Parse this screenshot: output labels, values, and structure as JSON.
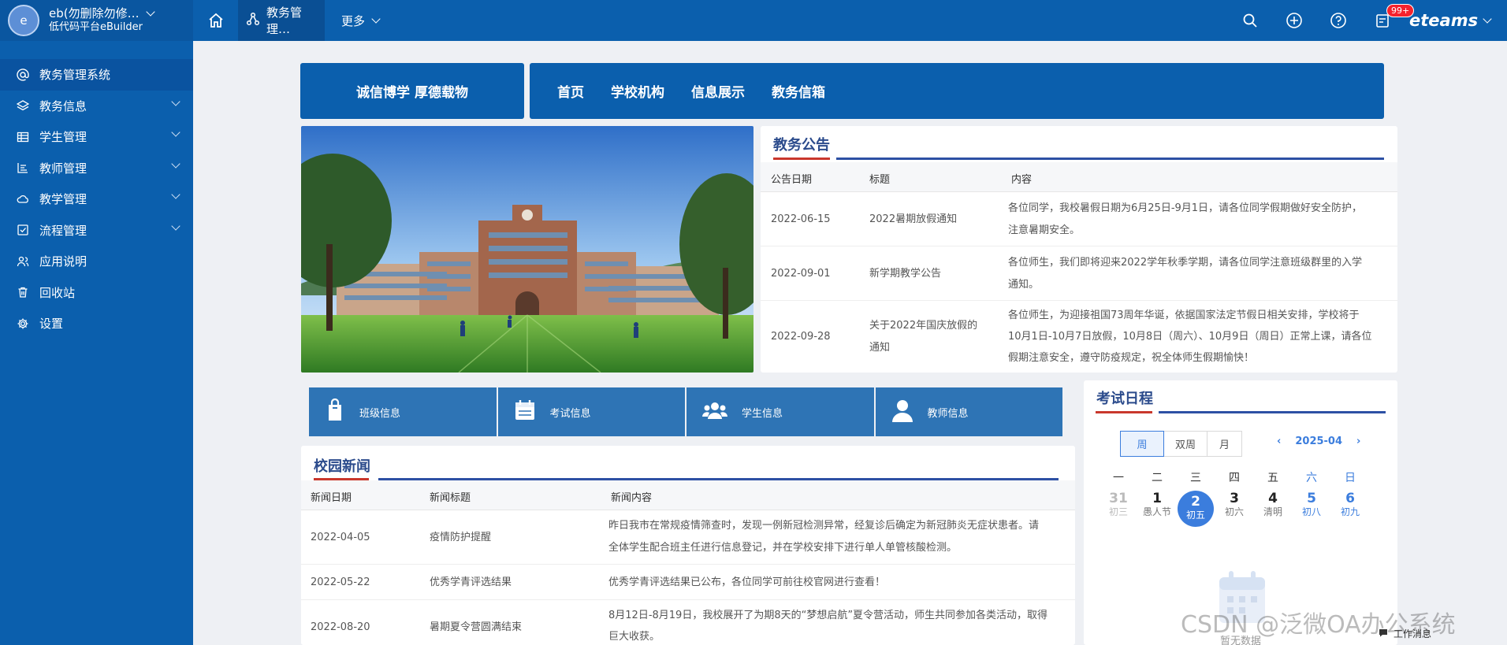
{
  "user": {
    "avatar_letter": "e",
    "name": "eb(勿删除勿修…",
    "subtitle": "低代码平台eBuilder"
  },
  "topnav": {
    "active_tab": "教务管理…",
    "more": "更多",
    "badge": "99+",
    "brand": "eteams"
  },
  "sidebar": {
    "items": [
      {
        "label": "教务管理系统",
        "icon": "at-icon",
        "expandable": false
      },
      {
        "label": "教务信息",
        "icon": "layers-icon",
        "expandable": true
      },
      {
        "label": "学生管理",
        "icon": "table-icon",
        "expandable": true
      },
      {
        "label": "教师管理",
        "icon": "list-icon",
        "expandable": true
      },
      {
        "label": "教学管理",
        "icon": "cloud-icon",
        "expandable": true
      },
      {
        "label": "流程管理",
        "icon": "checkbox-icon",
        "expandable": true
      },
      {
        "label": "应用说明",
        "icon": "users-icon",
        "expandable": false
      },
      {
        "label": "回收站",
        "icon": "trash-icon",
        "expandable": false
      },
      {
        "label": "设置",
        "icon": "gear-icon",
        "expandable": false
      }
    ]
  },
  "portal": {
    "motto": "诚信博学  厚德载物",
    "nav": [
      "首页",
      "学校机构",
      "信息展示",
      "教务信箱"
    ]
  },
  "notice": {
    "title": "教务公告",
    "headers": [
      "公告日期",
      "标题",
      "内容"
    ],
    "rows": [
      {
        "date": "2022-06-15",
        "title": "2022暑期放假通知",
        "content": [
          "各位同学，我校暑假日期为6月25日-9月1日，请各位同学假期做好安全防护，",
          "注意暑期安全。"
        ]
      },
      {
        "date": "2022-09-01",
        "title": "新学期教学公告",
        "content": [
          "各位师生，我们即将迎来2022学年秋季学期，请各位同学注意班级群里的入学",
          "通知。"
        ]
      },
      {
        "date": "2022-09-28",
        "title": [
          "关于2022年国庆放假的",
          "通知"
        ],
        "content": [
          "各位师生，为迎接祖国73周年华诞，依据国家法定节假日相关安排，学校将于",
          "10月1日-10月7日放假，10月8日（周六）、10月9日（周日）正常上课，请各位",
          "假期注意安全，遵守防疫规定，祝全体师生假期愉快！"
        ]
      }
    ]
  },
  "tiles": [
    {
      "label": "班级信息",
      "icon": "bag-icon"
    },
    {
      "label": "考试信息",
      "icon": "calendar-icon"
    },
    {
      "label": "学生信息",
      "icon": "group-icon"
    },
    {
      "label": "教师信息",
      "icon": "person-icon"
    }
  ],
  "news": {
    "title": "校园新闻",
    "headers": [
      "新闻日期",
      "新闻标题",
      "新闻内容"
    ],
    "rows": [
      {
        "date": "2022-04-05",
        "title": "疫情防护提醒",
        "content": [
          "昨日我市在常规疫情筛查时，发现一例新冠检测异常，经复诊后确定为新冠肺炎无症状患者。请",
          "全体学生配合班主任进行信息登记，并在学校安排下进行单人单管核酸检测。"
        ]
      },
      {
        "date": "2022-05-22",
        "title": "优秀学青评选结果",
        "content": [
          "优秀学青评选结果已公布，各位同学可前往校官网进行查看！"
        ]
      },
      {
        "date": "2022-08-20",
        "title": "暑期夏令营圆满结束",
        "content": [
          "8月12日-8月19日，我校展开了为期8天的“梦想启航”夏令营活动，师生共同参加各类活动，取得",
          "巨大收获。"
        ]
      }
    ]
  },
  "exam": {
    "title": "考试日程",
    "views": [
      "周",
      "双周",
      "月"
    ],
    "active_view": "周",
    "month": "2025-04",
    "weekdays": [
      "一",
      "二",
      "三",
      "四",
      "五",
      "六",
      "日"
    ],
    "days": [
      {
        "n": "31",
        "l": "初三",
        "state": "muted"
      },
      {
        "n": "1",
        "l": "愚人节",
        "state": ""
      },
      {
        "n": "2",
        "l": "初五",
        "state": "today"
      },
      {
        "n": "3",
        "l": "初六",
        "state": ""
      },
      {
        "n": "4",
        "l": "清明",
        "state": ""
      },
      {
        "n": "5",
        "l": "初八",
        "state": "weekend"
      },
      {
        "n": "6",
        "l": "初九",
        "state": "weekend"
      }
    ],
    "empty": "暂无数据"
  },
  "footer": {
    "watermark": "CSDN @泛微OA办公系统",
    "worknote": "工作消息"
  },
  "colors": {
    "primary": "#0b5fad",
    "tile": "#2e74b5",
    "title": "#2b4b8c",
    "accent_red": "#c9372c",
    "calendar_blue": "#3b7ddd"
  }
}
